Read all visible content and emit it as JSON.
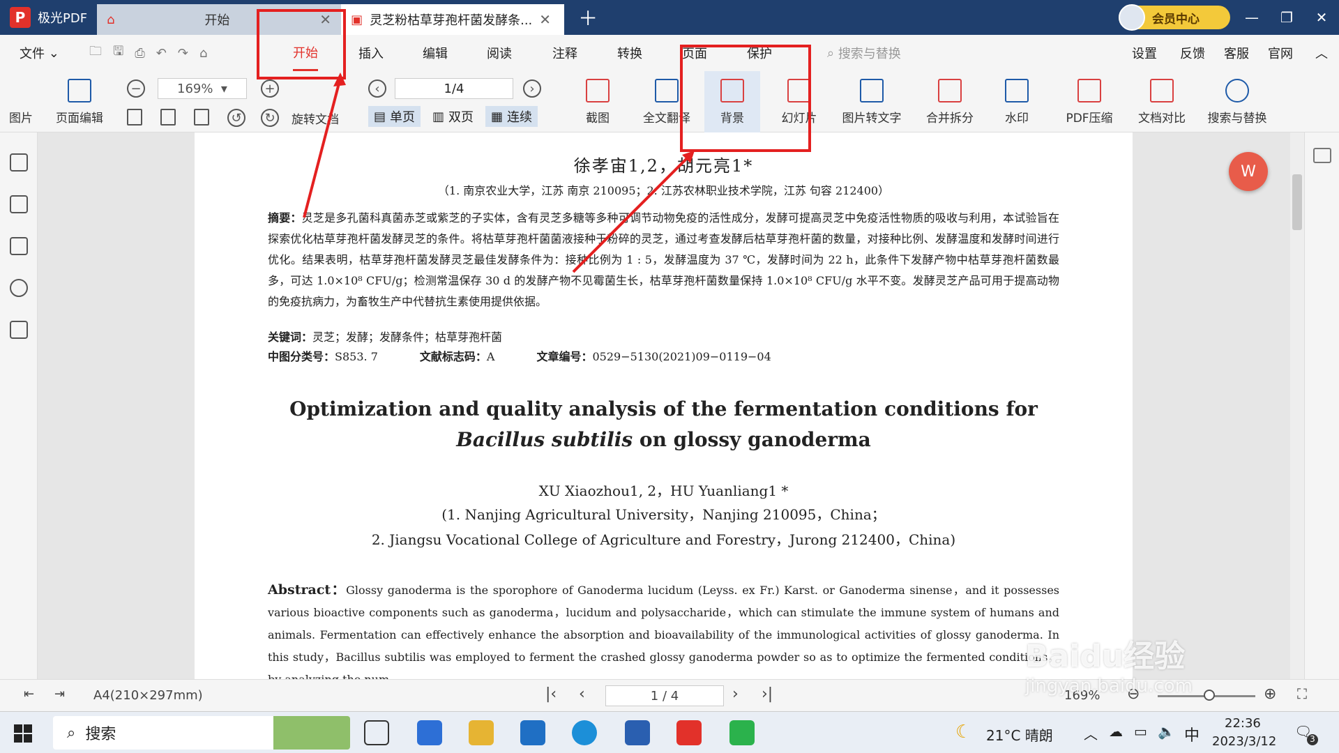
{
  "titlebar": {
    "app_name": "极光PDF",
    "home_tab": "开始",
    "doc_tab": "灵芝粉枯草芽孢杆菌发酵条...",
    "vip_label": "会员中心"
  },
  "menu": {
    "file": "文件",
    "items": [
      "开始",
      "插入",
      "编辑",
      "阅读",
      "注释",
      "转换",
      "页面",
      "保护"
    ],
    "active": "开始",
    "search_placeholder": "搜索与替换",
    "right": [
      "设置",
      "反馈",
      "客服",
      "官网"
    ]
  },
  "toolbar": {
    "left_cut": "图片",
    "page_edit": "页面编辑",
    "zoom": "169%",
    "page": "1/4",
    "rotate": "旋转文档",
    "view_single": "单页",
    "view_double": "双页",
    "view_continuous": "连续",
    "screenshot": "截图",
    "translate": "全文翻译",
    "background": "背景",
    "slideshow": "幻灯片",
    "img2text": "图片转文字",
    "merge_split": "合并拆分",
    "watermark": "水印",
    "compress": "PDF压缩",
    "compare": "文档对比",
    "search_replace": "搜索与替换"
  },
  "document": {
    "authors_cn": "徐孝宙1,2，胡元亮1*",
    "affil_cn": "（1. 南京农业大学，江苏 南京   210095；2. 江苏农林职业技术学院，江苏 句容   212400）",
    "abstract_label": "摘要：",
    "abstract_cn": "灵芝是多孔菌科真菌赤芝或紫芝的子实体，含有灵芝多糖等多种可调节动物免疫的活性成分，发酵可提高灵芝中免疫活性物质的吸收与利用，本试验旨在探索优化枯草芽孢杆菌发酵灵芝的条件。将枯草芽孢杆菌菌液接种于粉碎的灵芝，通过考查发酵后枯草芽孢杆菌的数量，对接种比例、发酵温度和发酵时间进行优化。结果表明，枯草芽孢杆菌发酵灵芝最佳发酵条件为：接种比例为 1 : 5，发酵温度为 37 ℃，发酵时间为 22 h，此条件下发酵产物中枯草芽孢杆菌数最多，可达 1.0×10⁸ CFU/g；检测常温保存 30 d 的发酵产物不见霉菌生长，枯草芽孢杆菌数量保持 1.0×10⁸ CFU/g 水平不变。发酵灵芝产品可用于提高动物的免疫抗病力，为畜牧生产中代替抗生素使用提供依据。",
    "keywords_label": "关键词：",
    "keywords": "灵芝；发酵；发酵条件；枯草芽孢杆菌",
    "clc_label": "中图分类号：",
    "clc": "S853. 7",
    "doccode_label": "文献标志码：",
    "doccode": "A",
    "articleno_label": "文章编号：",
    "articleno": "0529−5130(2021)09−0119−04",
    "title_en_1": "Optimization and quality analysis of the fermentation conditions for",
    "title_en_2a": "Bacillus subtilis",
    "title_en_2b": " on glossy ganoderma",
    "authors_en": "XU Xiaozhou1, 2，HU Yuanliang1 *",
    "affil_en_1": "(1.  Nanjing Agricultural University，Nanjing 210095，China；",
    "affil_en_2": "2.  Jiangsu Vocational College of Agriculture and Forestry，Jurong 212400，China)",
    "abstract_en_label": "Abstract：",
    "abstract_en": "Glossy ganoderma is the sporophore of Ganoderma lucidum (Leyss. ex Fr.) Karst. or Ganoderma sinense，and it possesses various bioactive components such as ganoderma，lucidum and polysaccharide，which can stimulate the immune system of humans and animals. Fermentation can effectively enhance the absorption and bioavailability of the immunological activities of glossy ganoderma. In this study，Bacillus subtilis was employed to ferment the crashed glossy ganoderma powder so as to optimize the fermented conditions，by analyzing the num-"
  },
  "status": {
    "page_size": "A4(210×297mm)",
    "page": "1 / 4",
    "zoom": "169%"
  },
  "taskbar": {
    "search": "搜索",
    "weather": "21°C  晴朗",
    "ime": "中",
    "time": "22:36",
    "date": "2023/3/12",
    "notif": "3"
  },
  "watermark": "Baidu经验",
  "watermark_sub": "jingyan.baidu.com",
  "colors": {
    "accent": "#e2312a",
    "titlebar": "#1f3f6e",
    "annotation": "#e42020"
  }
}
